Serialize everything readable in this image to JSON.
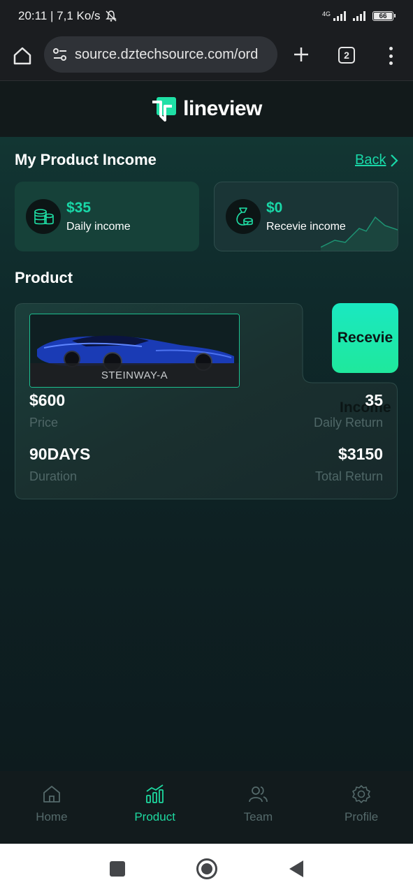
{
  "status_bar": {
    "time_speed": "20:11 | 7,1 Ko/s",
    "network_tag": "4G",
    "battery": "66"
  },
  "browser": {
    "url": "source.dztechsource.com/ord",
    "tab_count": "2"
  },
  "app": {
    "logo_text": "lineview"
  },
  "income_section": {
    "title": "My Product Income",
    "back_label": "Back",
    "daily": {
      "amount": "$35",
      "label": "Daily income",
      "icon": "coins-icon"
    },
    "receive": {
      "amount": "$0",
      "label": "Recevie income",
      "icon": "money-bag-icon"
    }
  },
  "product_section": {
    "title": "Product",
    "product": {
      "name": "STEINWAY-A",
      "price": "$600",
      "price_label": "Price",
      "daily_return": "35",
      "daily_return_label": "Daily Return",
      "duration": "90DAYS",
      "duration_label": "Duration",
      "total_return": "$3150",
      "total_return_label": "Total Return",
      "receive_label": "Recevie",
      "income_overlay": "Income"
    }
  },
  "bottom_nav": {
    "items": [
      {
        "label": "Home",
        "icon": "home-icon",
        "active": false
      },
      {
        "label": "Product",
        "icon": "bar-chart-icon",
        "active": true
      },
      {
        "label": "Team",
        "icon": "team-icon",
        "active": false
      },
      {
        "label": "Profile",
        "icon": "gear-icon",
        "active": false
      }
    ]
  },
  "colors": {
    "accent": "#19d8a8",
    "background": "#0f1b1d",
    "muted": "#556a6b"
  }
}
